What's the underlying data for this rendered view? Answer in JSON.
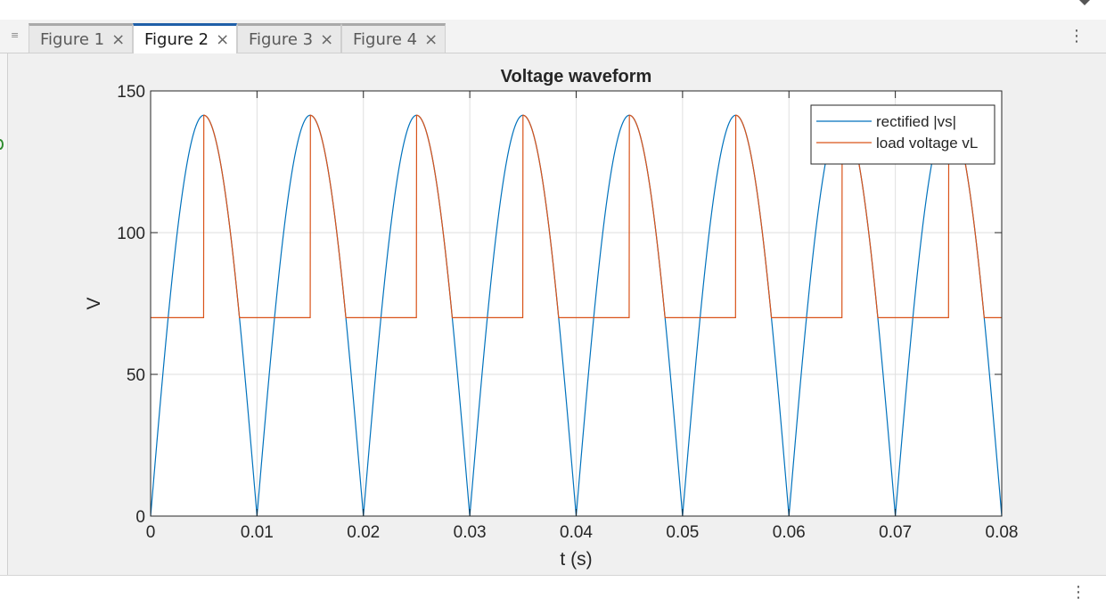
{
  "tabs": [
    {
      "label": "Figure 1",
      "active": false
    },
    {
      "label": "Figure 2",
      "active": true
    },
    {
      "label": "Figure 3",
      "active": false
    },
    {
      "label": "Figure 4",
      "active": false
    }
  ],
  "icons": {
    "tab_close": "×",
    "menu": "⋮",
    "grip": "≡"
  },
  "chart_data": {
    "type": "line",
    "title": "Voltage waveform",
    "xlabel": "t (s)",
    "ylabel": "V",
    "xlim": [
      0,
      0.08
    ],
    "ylim": [
      0,
      150
    ],
    "xticks": [
      0,
      0.01,
      0.02,
      0.03,
      0.04,
      0.05,
      0.06,
      0.07,
      0.08
    ],
    "xtick_labels": [
      "0",
      "0.01",
      "0.02",
      "0.03",
      "0.04",
      "0.05",
      "0.06",
      "0.07",
      "0.08"
    ],
    "yticks": [
      0,
      50,
      100,
      150
    ],
    "ytick_labels": [
      "0",
      "50",
      "100",
      "150"
    ],
    "grid": true,
    "legend_position": "top-right",
    "series": [
      {
        "name": "rectified |vs|",
        "color": "#0072BD",
        "function": "141.42*|sin(2*pi*50*t)|"
      },
      {
        "name": "load voltage vL",
        "color": "#D95319",
        "function": "follows |vs| from each peak at t=0.005+0.01k down to 70, holds at 70 until the next peak",
        "peak": 141.42,
        "hold_level": 70,
        "peak_times": [
          0.005,
          0.015,
          0.025,
          0.035,
          0.045,
          0.055,
          0.065,
          0.075
        ]
      }
    ]
  }
}
